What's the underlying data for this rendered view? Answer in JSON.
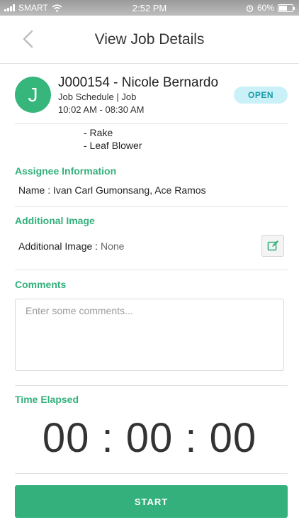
{
  "status_bar": {
    "carrier": "SMART",
    "time": "2:52 PM",
    "battery": "60%",
    "battery_level": 0.6
  },
  "nav": {
    "title": "View Job Details",
    "back_icon": "chevron-left-icon"
  },
  "job": {
    "avatar_letter": "J",
    "title": "J000154 - Nicole Bernardo",
    "subtitle": "Job Schedule | Job",
    "time_range": "10:02 AM - 08:30 AM",
    "status": "OPEN"
  },
  "tools": [
    "- Rake",
    "- Leaf Blower"
  ],
  "assignee": {
    "section_title": "Assignee Information",
    "label": "Name",
    "value": "Ivan Carl Gumonsang, Ace Ramos"
  },
  "additional_image": {
    "section_title": "Additional Image",
    "label": "Additional Image",
    "value": "None",
    "edit_icon": "edit-icon"
  },
  "comments": {
    "section_title": "Comments",
    "placeholder": "Enter some comments..."
  },
  "time_elapsed": {
    "section_title": "Time Elapsed",
    "hours": "00",
    "minutes": "00",
    "seconds": "00",
    "separator": ":"
  },
  "actions": {
    "start_label": "START"
  },
  "colors": {
    "accent": "#33b07b",
    "badge_bg": "#c9f1f7",
    "badge_text": "#1b9aaa"
  }
}
